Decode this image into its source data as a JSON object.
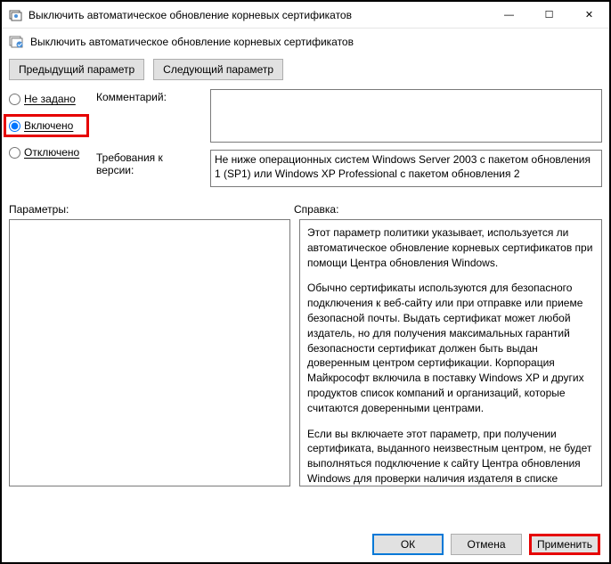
{
  "window": {
    "title": "Выключить автоматическое обновление корневых сертификатов",
    "subtitle": "Выключить автоматическое обновление корневых сертификатов",
    "minimize": "—",
    "maximize": "☐",
    "close": "✕"
  },
  "nav": {
    "prev": "Предыдущий параметр",
    "next": "Следующий параметр"
  },
  "radios": {
    "not_configured": "Не задано",
    "enabled": "Включено",
    "disabled": "Отключено",
    "selected": "enabled"
  },
  "fields": {
    "comment_label": "Комментарий:",
    "comment_value": "",
    "requirements_label": "Требования к версии:",
    "requirements_value": "Не ниже операционных систем Windows Server 2003 с пакетом обновления 1 (SP1) или Windows XP Professional с пакетом обновления 2"
  },
  "lower": {
    "params_label": "Параметры:",
    "help_label": "Справка:",
    "help_p1": "Этот параметр политики указывает, используется ли автоматическое обновление корневых сертификатов при помощи Центра обновления Windows.",
    "help_p2": "Обычно сертификаты используются для безопасного подключения к веб-сайту или при отправке или приеме безопасной почты. Выдать сертификат может любой издатель, но для получения максимальных гарантий безопасности сертификат должен быть выдан доверенным центром сертификации. Корпорация Майкрософт включила в поставку Windows XP и других продуктов список компаний и организаций, которые считаются доверенными центрами.",
    "help_p3": "Если вы включаете этот параметр, при получении сертификата, выданного неизвестным центром, не будет выполняться подключение к сайту Центра обновления Windows для проверки наличия издателя в списке доверенных центров сертификации Майкрософт."
  },
  "buttons": {
    "ok": "ОК",
    "cancel": "Отмена",
    "apply": "Применить"
  }
}
